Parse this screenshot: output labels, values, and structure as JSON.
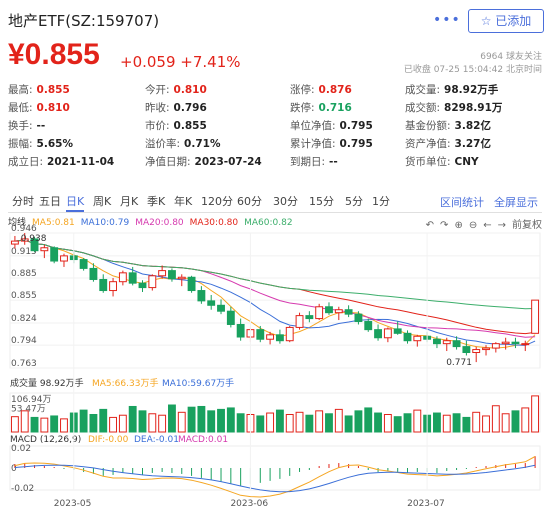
{
  "header": {
    "title": "地产ETF(SZ:159707)",
    "more_icon": "more-dots-icon",
    "follow_label": "☆ 已添加"
  },
  "quote": {
    "price": "¥0.855",
    "change": "+0.059",
    "change_pct": "+7.41%",
    "followers": "6964 球友关注",
    "status": "已收盘 07-25 15:04:42 北京时间"
  },
  "stats": [
    {
      "label": "最高:",
      "value": "0.855",
      "color": "red"
    },
    {
      "label": "今开:",
      "value": "0.810",
      "color": "red"
    },
    {
      "label": "涨停:",
      "value": "0.876",
      "color": "red"
    },
    {
      "label": "成交量:",
      "value": "98.92万手",
      "color": "black"
    },
    {
      "label": "最低:",
      "value": "0.810",
      "color": "red"
    },
    {
      "label": "昨收:",
      "value": "0.796",
      "color": "black"
    },
    {
      "label": "跌停:",
      "value": "0.716",
      "color": "green"
    },
    {
      "label": "成交额:",
      "value": "8298.91万",
      "color": "black"
    },
    {
      "label": "换手:",
      "value": "--",
      "color": "black"
    },
    {
      "label": "市价:",
      "value": "0.855",
      "color": "black"
    },
    {
      "label": "单位净值:",
      "value": "0.795",
      "color": "black"
    },
    {
      "label": "基金份额:",
      "value": "3.82亿",
      "color": "black"
    },
    {
      "label": "振幅:",
      "value": "5.65%",
      "color": "black"
    },
    {
      "label": "溢价率:",
      "value": "0.71%",
      "color": "black"
    },
    {
      "label": "累计净值:",
      "value": "0.795",
      "color": "black"
    },
    {
      "label": "资产净值:",
      "value": "3.27亿",
      "color": "black"
    },
    {
      "label": "成立日:",
      "value": "2021-11-04",
      "color": "black"
    },
    {
      "label": "净值日期:",
      "value": "2023-07-24",
      "color": "black"
    },
    {
      "label": "到期日:",
      "value": "--",
      "color": "black"
    },
    {
      "label": "货币单位:",
      "value": "CNY",
      "color": "black"
    }
  ],
  "tabs": [
    "分时",
    "五日",
    "日K",
    "周K",
    "月K",
    "季K",
    "年K",
    "120分",
    "60分",
    "30分",
    "15分",
    "5分",
    "1分"
  ],
  "active_tab": "日K",
  "tab_right": [
    "区间统计",
    "全屏显示"
  ],
  "kline_legend": {
    "prefix": "均线",
    "ma5": "MA5:0.81",
    "ma10": "MA10:0.79",
    "ma20": "MA20:0.80",
    "ma30": "MA30:0.80",
    "ma60": "MA60:0.82"
  },
  "tools": [
    "↶",
    "↷",
    "⊕",
    "⊖",
    "←",
    "→",
    "前复权"
  ],
  "price_axis": [
    "0.946",
    "0.915",
    "0.885",
    "0.855",
    "0.824",
    "0.794",
    "0.763"
  ],
  "annotations": {
    "high": "0.938",
    "low": "0.771"
  },
  "vol_legend": {
    "vol": "成交量 98.92万手",
    "ma5": "MA5:66.33万手",
    "ma10": "MA10:59.67万手"
  },
  "vol_axis": [
    "106.94万",
    "53.47万"
  ],
  "macd_legend": {
    "name": "MACD (12,26,9)",
    "dif": "DIF:-0.00",
    "dea": "DEA:-0.01",
    "macd": "MACD:0.01"
  },
  "macd_axis": [
    "0.02",
    "0",
    "-0.02"
  ],
  "dates": [
    "2023-05",
    "2023-06",
    "2023-07"
  ],
  "chart_data": {
    "type": "candlestick",
    "ohlc": [
      [
        0.931,
        0.942,
        0.925,
        0.935
      ],
      [
        0.935,
        0.946,
        0.93,
        0.938
      ],
      [
        0.938,
        0.941,
        0.92,
        0.922
      ],
      [
        0.922,
        0.93,
        0.912,
        0.926
      ],
      [
        0.926,
        0.928,
        0.905,
        0.908
      ],
      [
        0.908,
        0.918,
        0.9,
        0.915
      ],
      [
        0.915,
        0.92,
        0.905,
        0.91
      ],
      [
        0.91,
        0.912,
        0.895,
        0.898
      ],
      [
        0.898,
        0.905,
        0.88,
        0.883
      ],
      [
        0.883,
        0.89,
        0.865,
        0.868
      ],
      [
        0.868,
        0.885,
        0.86,
        0.88
      ],
      [
        0.88,
        0.895,
        0.875,
        0.892
      ],
      [
        0.892,
        0.9,
        0.875,
        0.878
      ],
      [
        0.878,
        0.882,
        0.866,
        0.872
      ],
      [
        0.872,
        0.89,
        0.868,
        0.888
      ],
      [
        0.888,
        0.902,
        0.884,
        0.895
      ],
      [
        0.895,
        0.898,
        0.88,
        0.884
      ],
      [
        0.884,
        0.89,
        0.874,
        0.886
      ],
      [
        0.886,
        0.888,
        0.865,
        0.868
      ],
      [
        0.868,
        0.874,
        0.85,
        0.854
      ],
      [
        0.854,
        0.862,
        0.842,
        0.848
      ],
      [
        0.848,
        0.856,
        0.836,
        0.84
      ],
      [
        0.84,
        0.846,
        0.818,
        0.822
      ],
      [
        0.822,
        0.83,
        0.8,
        0.805
      ],
      [
        0.805,
        0.818,
        0.798,
        0.815
      ],
      [
        0.815,
        0.82,
        0.798,
        0.802
      ],
      [
        0.802,
        0.812,
        0.795,
        0.808
      ],
      [
        0.808,
        0.815,
        0.796,
        0.8
      ],
      [
        0.8,
        0.82,
        0.798,
        0.818
      ],
      [
        0.818,
        0.838,
        0.815,
        0.834
      ],
      [
        0.834,
        0.84,
        0.825,
        0.83
      ],
      [
        0.83,
        0.85,
        0.828,
        0.846
      ],
      [
        0.846,
        0.852,
        0.835,
        0.838
      ],
      [
        0.838,
        0.846,
        0.828,
        0.842
      ],
      [
        0.842,
        0.848,
        0.832,
        0.836
      ],
      [
        0.836,
        0.84,
        0.822,
        0.826
      ],
      [
        0.826,
        0.83,
        0.812,
        0.815
      ],
      [
        0.815,
        0.822,
        0.8,
        0.804
      ],
      [
        0.804,
        0.818,
        0.798,
        0.816
      ],
      [
        0.816,
        0.826,
        0.808,
        0.81
      ],
      [
        0.81,
        0.814,
        0.796,
        0.8
      ],
      [
        0.8,
        0.808,
        0.792,
        0.806
      ],
      [
        0.806,
        0.812,
        0.798,
        0.802
      ],
      [
        0.802,
        0.806,
        0.79,
        0.796
      ],
      [
        0.796,
        0.804,
        0.786,
        0.8
      ],
      [
        0.8,
        0.806,
        0.788,
        0.792
      ],
      [
        0.792,
        0.8,
        0.78,
        0.784
      ],
      [
        0.784,
        0.792,
        0.771,
        0.788
      ],
      [
        0.788,
        0.794,
        0.78,
        0.79
      ],
      [
        0.79,
        0.798,
        0.784,
        0.796
      ],
      [
        0.796,
        0.804,
        0.788,
        0.798
      ],
      [
        0.798,
        0.804,
        0.79,
        0.796
      ],
      [
        0.796,
        0.8,
        0.786,
        0.796
      ],
      [
        0.81,
        0.855,
        0.81,
        0.855
      ]
    ],
    "volume": [
      42,
      58,
      40,
      38,
      44,
      36,
      52,
      60,
      48,
      62,
      40,
      46,
      70,
      58,
      50,
      46,
      74,
      54,
      68,
      70,
      58,
      62,
      66,
      50,
      48,
      44,
      52,
      60,
      48,
      54,
      46,
      58,
      50,
      62,
      44,
      58,
      66,
      52,
      48,
      42,
      50,
      60,
      46,
      52,
      46,
      50,
      40,
      54,
      44,
      72,
      50,
      58,
      66,
      99
    ],
    "macd": [
      0.004,
      0.005,
      0.003,
      0.002,
      0.001,
      -0.001,
      -0.002,
      -0.004,
      -0.006,
      -0.008,
      -0.007,
      -0.005,
      -0.006,
      -0.007,
      -0.005,
      -0.004,
      -0.005,
      -0.006,
      -0.008,
      -0.01,
      -0.012,
      -0.014,
      -0.016,
      -0.018,
      -0.016,
      -0.015,
      -0.013,
      -0.011,
      -0.008,
      -0.004,
      -0.002,
      0.002,
      0.004,
      0.005,
      0.004,
      0.002,
      -0.002,
      -0.004,
      -0.003,
      -0.004,
      -0.005,
      -0.004,
      -0.004,
      -0.005,
      -0.003,
      -0.002,
      -0.001,
      0.001,
      0.002,
      0.003,
      0.004,
      0.004,
      0.005,
      0.012
    ],
    "ylim": [
      0.763,
      0.946
    ]
  }
}
